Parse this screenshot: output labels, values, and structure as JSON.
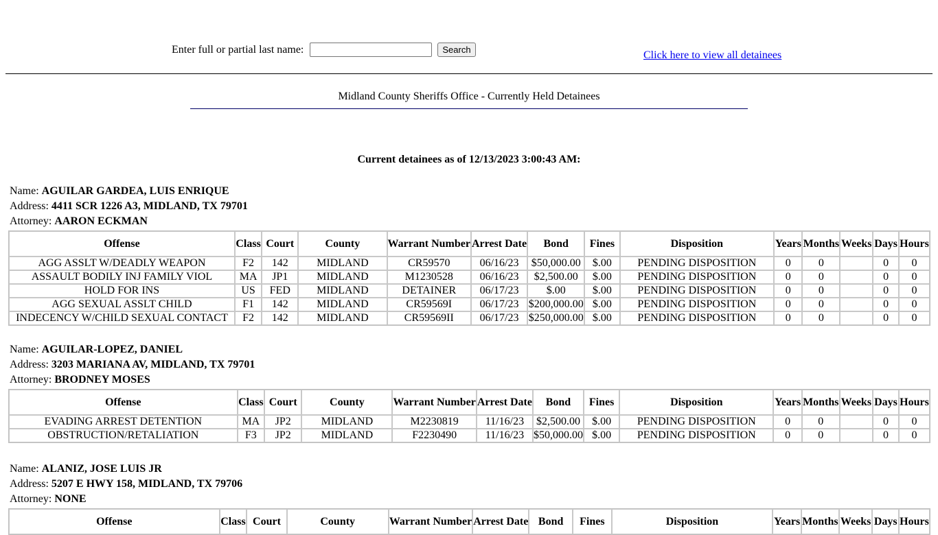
{
  "search": {
    "label": "Enter full or partial last name:",
    "value": "",
    "button_label": "Search"
  },
  "view_all_link": "Click here to view all detainees",
  "office_title": "Midland County Sheriffs Office - Currently Held Detainees",
  "as_of": "Current detainees as of 12/13/2023 3:00:43 AM:",
  "labels": {
    "name": "Name:",
    "address": "Address:",
    "attorney": "Attorney:"
  },
  "columns": [
    "Offense",
    "Class",
    "Court",
    "County",
    "Warrant Number",
    "Arrest Date",
    "Bond",
    "Fines",
    "Disposition",
    "Years",
    "Months",
    "Weeks",
    "Days",
    "Hours"
  ],
  "detainees": [
    {
      "name": "AGUILAR GARDEA, LUIS ENRIQUE",
      "address": "4411 SCR 1226 A3, MIDLAND, TX 79701",
      "attorney": "AARON ECKMAN",
      "charges": [
        [
          "AGG ASSLT W/DEADLY WEAPON",
          "F2",
          "142",
          "MIDLAND",
          "CR59570",
          "06/16/23",
          "$50,000.00",
          "$.00",
          "PENDING DISPOSITION",
          "0",
          "0",
          "",
          "0",
          "0"
        ],
        [
          "ASSAULT BODILY INJ FAMILY VIOL",
          "MA",
          "JP1",
          "MIDLAND",
          "M1230528",
          "06/16/23",
          "$2,500.00",
          "$.00",
          "PENDING DISPOSITION",
          "0",
          "0",
          "",
          "0",
          "0"
        ],
        [
          "HOLD FOR INS",
          "US",
          "FED",
          "MIDLAND",
          "DETAINER",
          "06/17/23",
          "$.00",
          "$.00",
          "PENDING DISPOSITION",
          "0",
          "0",
          "",
          "0",
          "0"
        ],
        [
          "AGG SEXUAL ASSLT CHILD",
          "F1",
          "142",
          "MIDLAND",
          "CR59569I",
          "06/17/23",
          "$200,000.00",
          "$.00",
          "PENDING DISPOSITION",
          "0",
          "0",
          "",
          "0",
          "0"
        ],
        [
          "INDECENCY W/CHILD SEXUAL CONTACT",
          "F2",
          "142",
          "MIDLAND",
          "CR59569II",
          "06/17/23",
          "$250,000.00",
          "$.00",
          "PENDING DISPOSITION",
          "0",
          "0",
          "",
          "0",
          "0"
        ]
      ]
    },
    {
      "name": "AGUILAR-LOPEZ, DANIEL",
      "address": "3203 MARIANA AV, MIDLAND, TX 79701",
      "attorney": "BRODNEY MOSES",
      "charges": [
        [
          "EVADING ARREST DETENTION",
          "MA",
          "JP2",
          "MIDLAND",
          "M2230819",
          "11/16/23",
          "$2,500.00",
          "$.00",
          "PENDING DISPOSITION",
          "0",
          "0",
          "",
          "0",
          "0"
        ],
        [
          "OBSTRUCTION/RETALIATION",
          "F3",
          "JP2",
          "MIDLAND",
          "F2230490",
          "11/16/23",
          "$50,000.00",
          "$.00",
          "PENDING DISPOSITION",
          "0",
          "0",
          "",
          "0",
          "0"
        ]
      ]
    },
    {
      "name": "ALANIZ, JOSE LUIS JR",
      "address": "5207 E HWY 158, MIDLAND, TX 79706",
      "attorney": "NONE",
      "charges": []
    }
  ]
}
